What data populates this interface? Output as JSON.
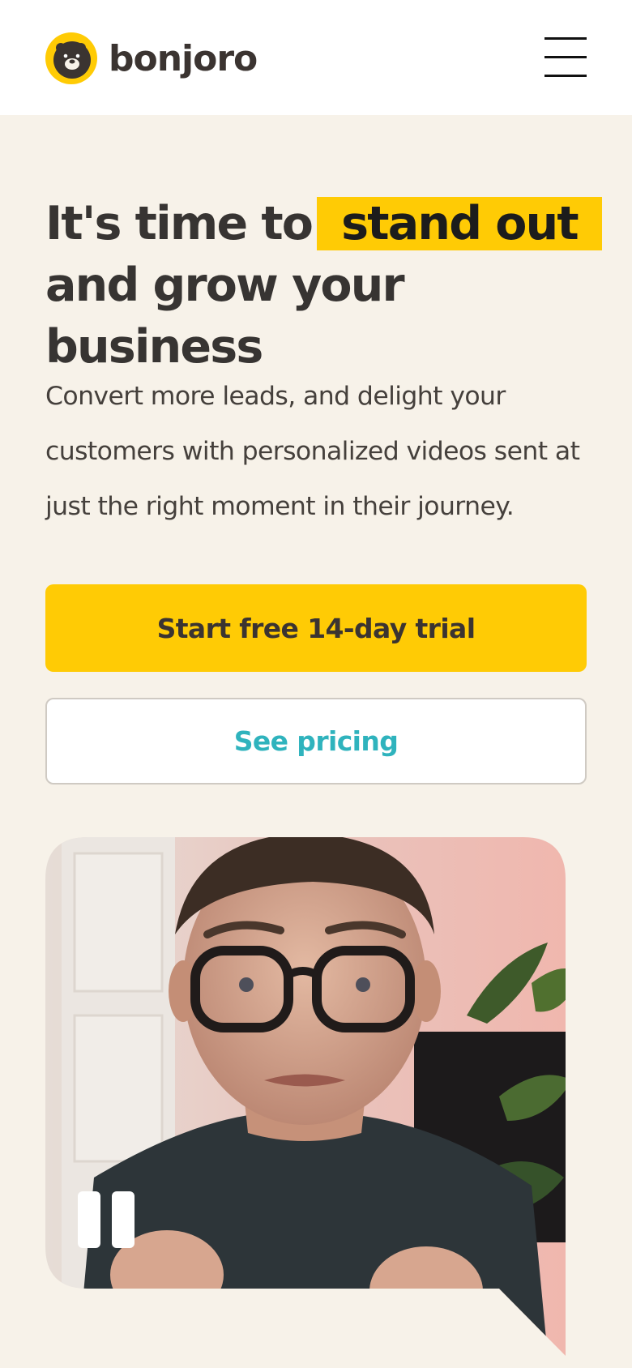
{
  "header": {
    "brand": "bonjoro",
    "menu_icon": "hamburger-menu-icon",
    "logo_icon": "bear-face-icon"
  },
  "hero": {
    "headline_part1": "It's time to",
    "headline_highlight": "stand out",
    "headline_part2": "and grow your business",
    "subcopy": "Convert more leads, and delight your customers with personalized videos sent at just the right moment in their journey.",
    "primary_cta": "Start free 14-day trial",
    "secondary_cta": "See pricing"
  },
  "video": {
    "pause_icon": "pause-icon"
  },
  "colors": {
    "accent": "#ffcb05",
    "background": "#f7f2e9",
    "link": "#2fb3bd",
    "text": "#373432"
  }
}
